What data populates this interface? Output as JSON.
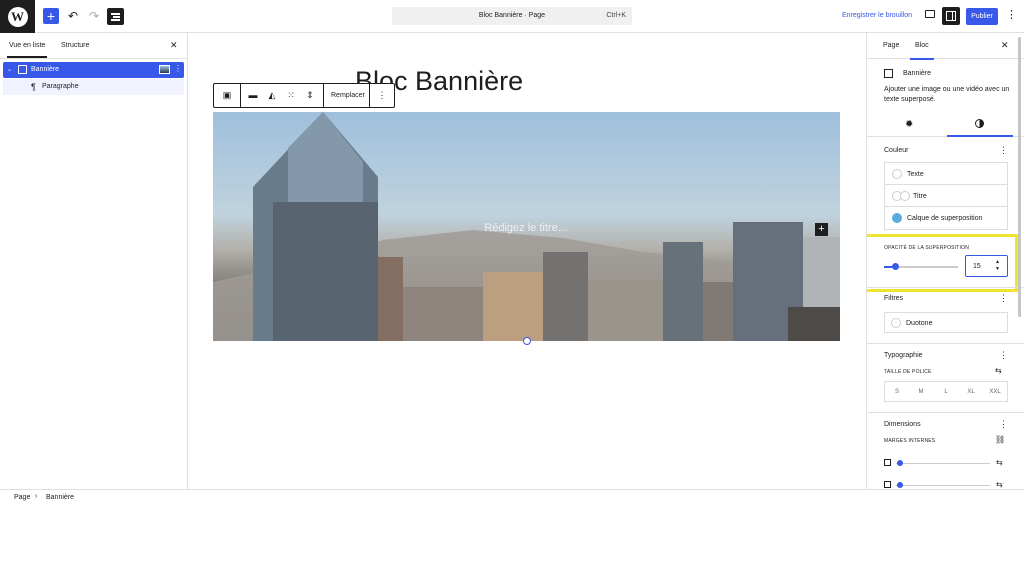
{
  "topbar": {
    "wp_logo": "W",
    "add_icon": "+",
    "undo_icon": "↶",
    "redo_icon": "↷",
    "command_title": "Bloc Bannière · Page",
    "command_shortcut": "Ctrl+K",
    "save_draft": "Enregistrer le brouillon",
    "publish": "Publier",
    "more_icon": "⋮",
    "accent": "#3858e9"
  },
  "listview": {
    "tab_list": "Vue en liste",
    "tab_structure": "Structure",
    "close": "✕",
    "items": [
      {
        "label": "Bannière",
        "caret": "⌄",
        "icon": "cover-block-icon",
        "selected": true
      },
      {
        "label": "Paragraphe",
        "icon": "¶"
      }
    ],
    "row_options": "⋮"
  },
  "canvas": {
    "page_title": "Bloc Bannière",
    "toolbar": {
      "block_icon": "▣",
      "align_icon": "▬",
      "position_icon": "◭",
      "full_height_icon": "⁙",
      "height_icon": "⇕",
      "replace": "Remplacer",
      "more": "⋮"
    },
    "cover_heading_placeholder": "Rédigez le titre…",
    "cover_plus": "+"
  },
  "settings": {
    "tab_page": "Page",
    "tab_block": "Bloc",
    "close": "✕",
    "block_name": "Bannière",
    "block_description": "Ajouter une image ou une vidéo avec un texte superposé.",
    "gear_icon": "✹",
    "color_panel": {
      "title": "Couleur",
      "items": [
        {
          "label": "Texte",
          "color": "#ffffff"
        },
        {
          "label": "Titre",
          "color": "#ffffff"
        },
        {
          "label": "Calque de superposition",
          "color": "#5aaae0"
        }
      ]
    },
    "overlay_opacity": {
      "label": "OPACITÉ DE LA SUPERPOSITION",
      "value": "15",
      "fraction": 0.15,
      "spin_up": "▲",
      "spin_down": "▼"
    },
    "filters": {
      "title": "Filtres",
      "duotone": "Duotone"
    },
    "typography": {
      "title": "Typographie",
      "font_size_label": "TAILLE DE POLICE",
      "sizes": [
        "S",
        "M",
        "L",
        "XL",
        "XXL"
      ],
      "adjust_icon": "⇆"
    },
    "dimensions": {
      "title": "Dimensions",
      "padding_label": "MARGES INTERNES",
      "link_icon": "⛓",
      "adjust_icon": "⇆"
    },
    "panel_dots": "⋮"
  },
  "footer": {
    "crumb_page": "Page",
    "sep": "›",
    "crumb_block": "Bannière"
  }
}
